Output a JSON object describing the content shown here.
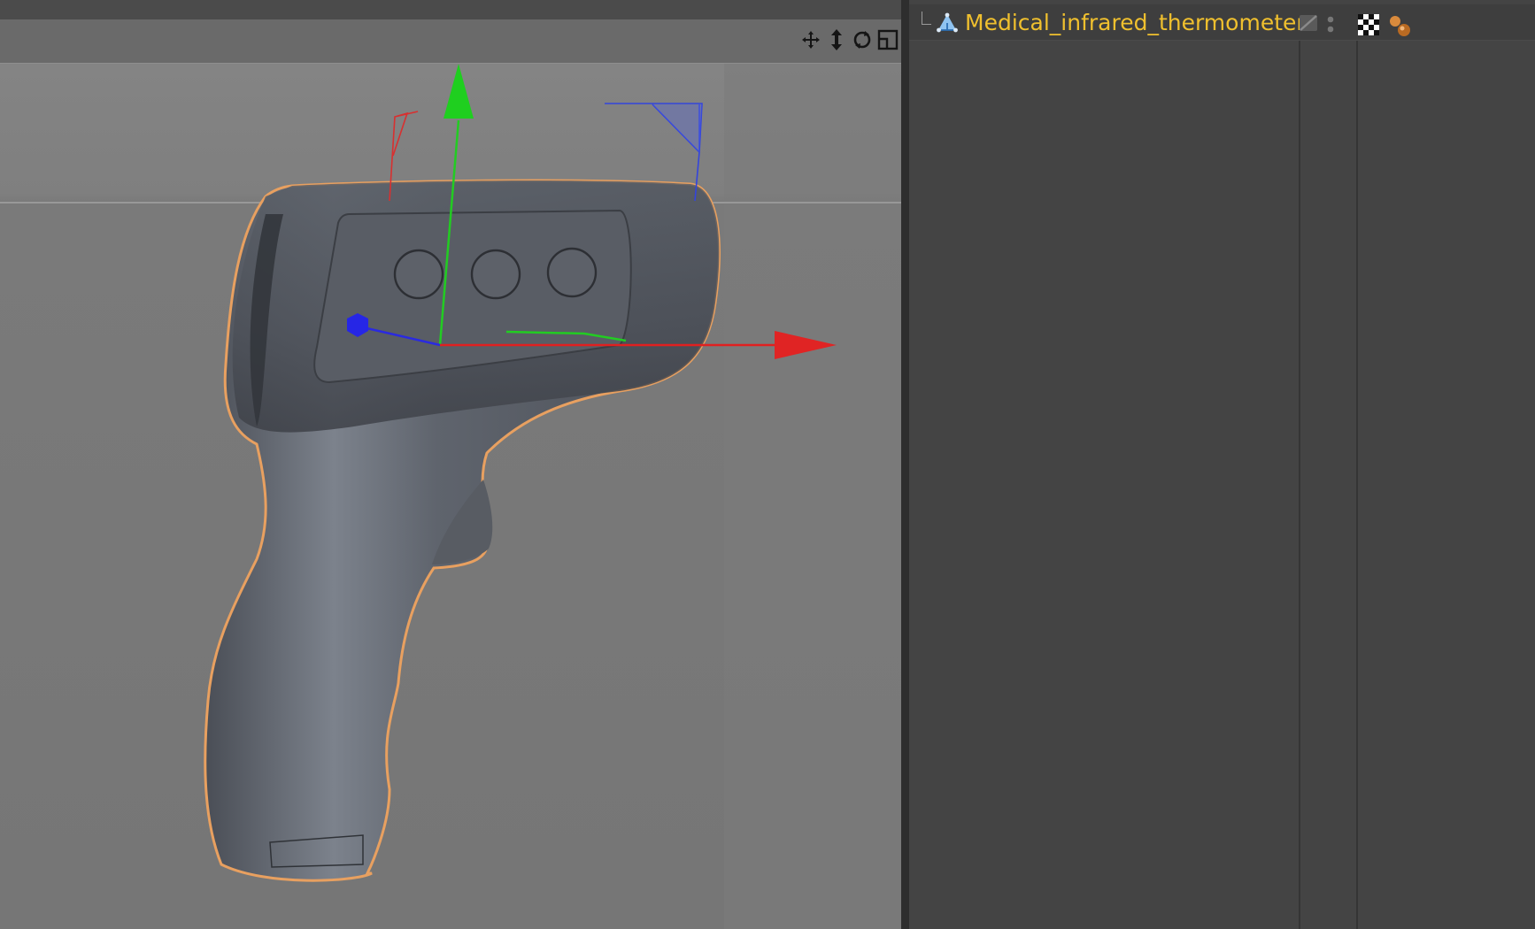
{
  "viewport": {
    "icons": [
      "move-view-icon",
      "dolly-view-icon",
      "rotate-view-icon",
      "maximize-view-icon"
    ]
  },
  "object_manager": {
    "objects": [
      {
        "name": "Medical_infrared_thermometer",
        "icon": "polygon-object-icon",
        "tags": [
          "checker-texture-tag-icon",
          "material-tag-icon"
        ]
      }
    ]
  },
  "colors": {
    "selection": "#f0c02e",
    "axis_x": "#e02020",
    "axis_y": "#22cc22",
    "axis_z": "#2a2ae0",
    "model": "#5a5e66",
    "outline": "#e8a060"
  }
}
